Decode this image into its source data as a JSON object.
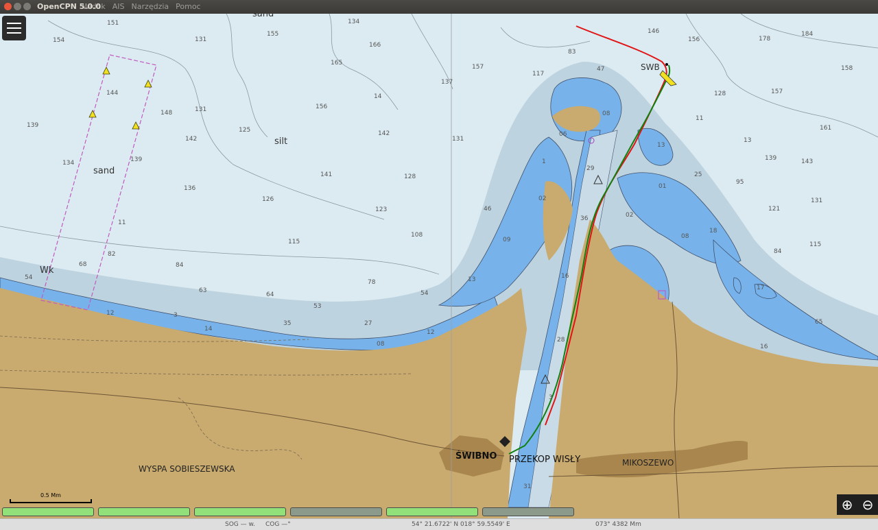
{
  "window": {
    "title": "OpenCPN 5.0.0"
  },
  "menu": [
    "Widok",
    "AIS",
    "Narzędzia",
    "Pomoc"
  ],
  "chart": {
    "labels": {
      "sand_top": "sand",
      "sand_mid": "sand",
      "silt": "silt",
      "wk": "Wk",
      "swb": "SWB",
      "swibno": "ŚWIBNO",
      "przekop": "PRZEKOP WISŁY",
      "mikoszewo": "MIKOSZEWO",
      "wyspa": "WYSPA SOBIESZEWSKA"
    },
    "soundings": [
      [
        "15",
        "151"
      ],
      [
        "15",
        "154"
      ],
      [
        "13",
        "131"
      ],
      [
        "15",
        "155"
      ],
      [
        "16",
        "165"
      ],
      [
        "13",
        "134"
      ],
      [
        "16",
        "166"
      ],
      [
        "14",
        "144"
      ],
      [
        "14",
        "148"
      ],
      [
        "14",
        "142"
      ],
      [
        "13",
        "139"
      ],
      [
        "14",
        "14"
      ],
      [
        "13",
        "131"
      ],
      [
        "12",
        "125"
      ],
      [
        "15",
        "156"
      ],
      [
        "13",
        "134"
      ],
      [
        "13",
        "139"
      ],
      [
        "14",
        "142"
      ],
      [
        "14",
        "141"
      ],
      [
        "12",
        "128"
      ],
      [
        "13",
        "136"
      ],
      [
        "12",
        "126"
      ],
      [
        "12",
        "123"
      ],
      [
        "11",
        "11"
      ],
      [
        "11",
        "115"
      ],
      [
        "10",
        "108"
      ],
      [
        "8",
        "82"
      ],
      [
        "6",
        "68"
      ],
      [
        "8",
        "84"
      ],
      [
        "6",
        "63"
      ],
      [
        "5",
        "54"
      ],
      [
        "6",
        "64"
      ],
      [
        "7",
        "78"
      ],
      [
        "5",
        "53"
      ],
      [
        "5",
        "54"
      ],
      [
        "3",
        "3"
      ],
      [
        "3",
        "35"
      ],
      [
        "2",
        "27"
      ],
      [
        "1",
        "12"
      ],
      [
        "1",
        "14"
      ],
      [
        "0",
        "08"
      ],
      [
        "1",
        "12"
      ],
      [
        "13",
        "137"
      ],
      [
        "13",
        "131"
      ],
      [
        "15",
        "157"
      ],
      [
        "11",
        "117"
      ],
      [
        "8",
        "83"
      ],
      [
        "4",
        "47"
      ],
      [
        "4",
        "46"
      ],
      [
        "0",
        "08"
      ],
      [
        "0",
        "06"
      ],
      [
        "1",
        "1"
      ],
      [
        "0",
        "02"
      ],
      [
        "0",
        "09"
      ],
      [
        "1",
        "13"
      ],
      [
        "1",
        "16"
      ],
      [
        "1",
        "13"
      ],
      [
        "0",
        "01"
      ],
      [
        "0",
        "08"
      ],
      [
        "1",
        "18"
      ],
      [
        "2",
        "29"
      ],
      [
        "2",
        "25"
      ],
      [
        "1",
        "17"
      ],
      [
        "1",
        "16"
      ],
      [
        "6",
        "65"
      ],
      [
        "8",
        "84"
      ],
      [
        "11",
        "115"
      ],
      [
        "12",
        "121"
      ],
      [
        "13",
        "131"
      ],
      [
        "9",
        "95"
      ],
      [
        "14",
        "143"
      ],
      [
        "13",
        "139"
      ],
      [
        "13",
        "13"
      ],
      [
        "14",
        "146"
      ],
      [
        "15",
        "156"
      ],
      [
        "17",
        "178"
      ],
      [
        "18",
        "184"
      ],
      [
        "15",
        "158"
      ],
      [
        "16",
        "161"
      ],
      [
        "15",
        "157"
      ],
      [
        "12",
        "128"
      ],
      [
        "11",
        "11"
      ],
      [
        "0",
        "02"
      ],
      [
        "3",
        "36"
      ],
      [
        "2",
        "28"
      ],
      [
        "3",
        "3"
      ],
      [
        "3",
        "31"
      ]
    ]
  },
  "scale_label": "0.5 Mm",
  "piano_keys": [
    "on",
    "on",
    "on",
    "off",
    "on",
    "off"
  ],
  "status": {
    "sog": "SOG — w.",
    "cog": "COG —°",
    "position": "54° 21.6722' N   018° 59.5549' E",
    "bearing": "073° 4382 Mm"
  }
}
